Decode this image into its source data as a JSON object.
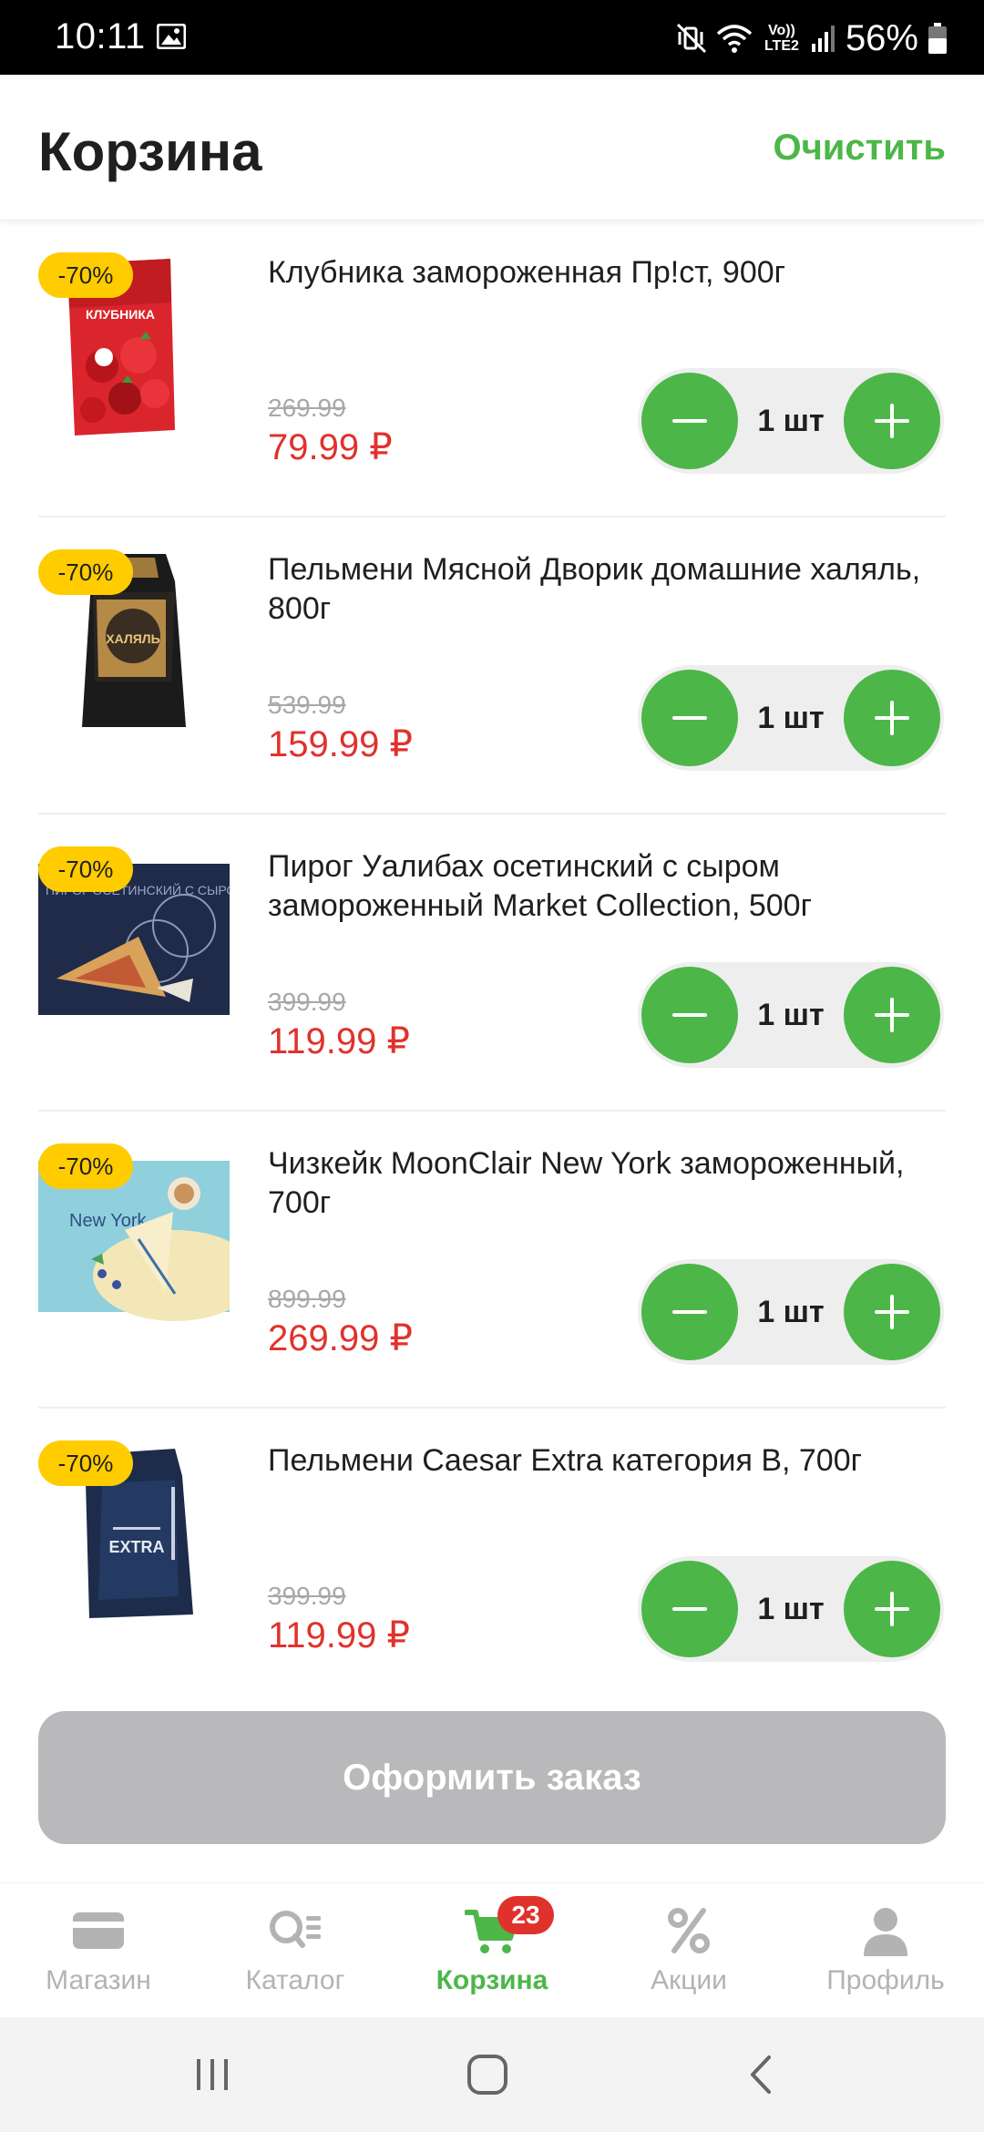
{
  "status_bar": {
    "time": "10:11",
    "network": "Vo)) LTE2",
    "battery": "56%"
  },
  "header": {
    "title": "Корзина",
    "clear_label": "Очистить"
  },
  "items": [
    {
      "discount": "-70%",
      "name": "Клубника замороженная Пр!ст, 900г",
      "old_price": "269.99",
      "price": "79.99 ₽",
      "quantity": "1 шт",
      "image_kind": "strawberry-pack-image",
      "package_text": "КЛУБНИКА"
    },
    {
      "discount": "-70%",
      "name": "Пельмени Мясной Дворик домашние халяль, 800г",
      "old_price": "539.99",
      "price": "159.99 ₽",
      "quantity": "1 шт",
      "image_kind": "dumplings-bag-image",
      "package_text": "ХАЛЯЛЬ"
    },
    {
      "discount": "-70%",
      "name": "Пирог Уалибах осетинский с сыром замороженный Market Collection, 500г",
      "old_price": "399.99",
      "price": "119.99 ₽",
      "quantity": "1 шт",
      "image_kind": "pie-box-image",
      "package_text": "ПИРОГ ОСЕТИНСКИЙ С СЫРОМ «УАЛИБАХ»"
    },
    {
      "discount": "-70%",
      "name": "Чизкейк MoonClair New York замороженный, 700г",
      "old_price": "899.99",
      "price": "269.99 ₽",
      "quantity": "1 шт",
      "image_kind": "cheesecake-box-image",
      "package_text": "New York"
    },
    {
      "discount": "-70%",
      "name": "Пельмени Caesar Extra категория В, 700г",
      "old_price": "399.99",
      "price": "119.99 ₽",
      "quantity": "1 шт",
      "image_kind": "caesar-bag-image",
      "package_text": "EXTRA"
    }
  ],
  "checkout_label": "Оформить заказ",
  "bottom_nav": {
    "items": [
      {
        "label": "Магазин",
        "icon": "card-icon"
      },
      {
        "label": "Каталог",
        "icon": "catalog-search-icon"
      },
      {
        "label": "Корзина",
        "icon": "cart-icon",
        "active": true,
        "badge": "23"
      },
      {
        "label": "Акции",
        "icon": "percent-icon"
      },
      {
        "label": "Профиль",
        "icon": "profile-icon"
      }
    ]
  },
  "colors": {
    "accent_green": "#4cb748",
    "price_red": "#e0322c",
    "discount_yellow": "#ffcc00",
    "disabled_button": "#b9b9bc"
  }
}
